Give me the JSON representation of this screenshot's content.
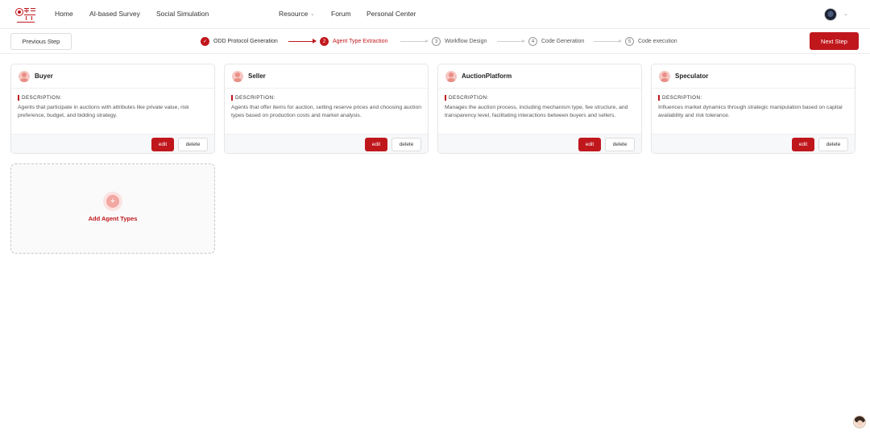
{
  "nav": {
    "logo_icon": "brand-logo-icon",
    "links": [
      "Home",
      "AI-based Survey",
      "Social Simulation"
    ],
    "resource_label": "Resource",
    "forum_label": "Forum",
    "personal_center_label": "Personal Center",
    "avatar_icon": "user-avatar-icon",
    "chevron_icon": "chevron-down-icon"
  },
  "stepbar": {
    "prev_label": "Previous Step",
    "next_label": "Next Step",
    "steps": [
      {
        "number": "1",
        "label": "ODD Protocol Generation",
        "state": "done",
        "icon": "check-icon"
      },
      {
        "number": "2",
        "label": "Agent Type Extraction",
        "state": "active"
      },
      {
        "number": "3",
        "label": "Workflow Design",
        "state": "todo"
      },
      {
        "number": "4",
        "label": "Code Generation",
        "state": "todo"
      },
      {
        "number": "5",
        "label": "Code execution",
        "state": "todo"
      }
    ]
  },
  "description_label": "DESCRIPTION:",
  "edit_label": "edit",
  "delete_label": "delete",
  "agents": [
    {
      "name": "Buyer",
      "description": "Agents that participate in auctions with attributes like private value, risk preference, budget, and bidding strategy."
    },
    {
      "name": "Seller",
      "description": "Agents that offer items for auction, setting reserve prices and choosing auction types based on production costs and market analysis."
    },
    {
      "name": "AuctionPlatform",
      "description": "Manages the auction process, including mechanism type, fee structure, and transparency level, facilitating interactions between buyers and sellers."
    },
    {
      "name": "Speculator",
      "description": "Influences market dynamics through strategic manipulation based on capital availability and risk tolerance."
    }
  ],
  "add_card": {
    "label": "Add Agent Types",
    "icon": "plus-icon"
  },
  "assistant_icon": "assistant-avatar-icon",
  "colors": {
    "accent": "#c0171d",
    "border": "#e6e6e6",
    "muted_bg": "#f7f8fa"
  }
}
